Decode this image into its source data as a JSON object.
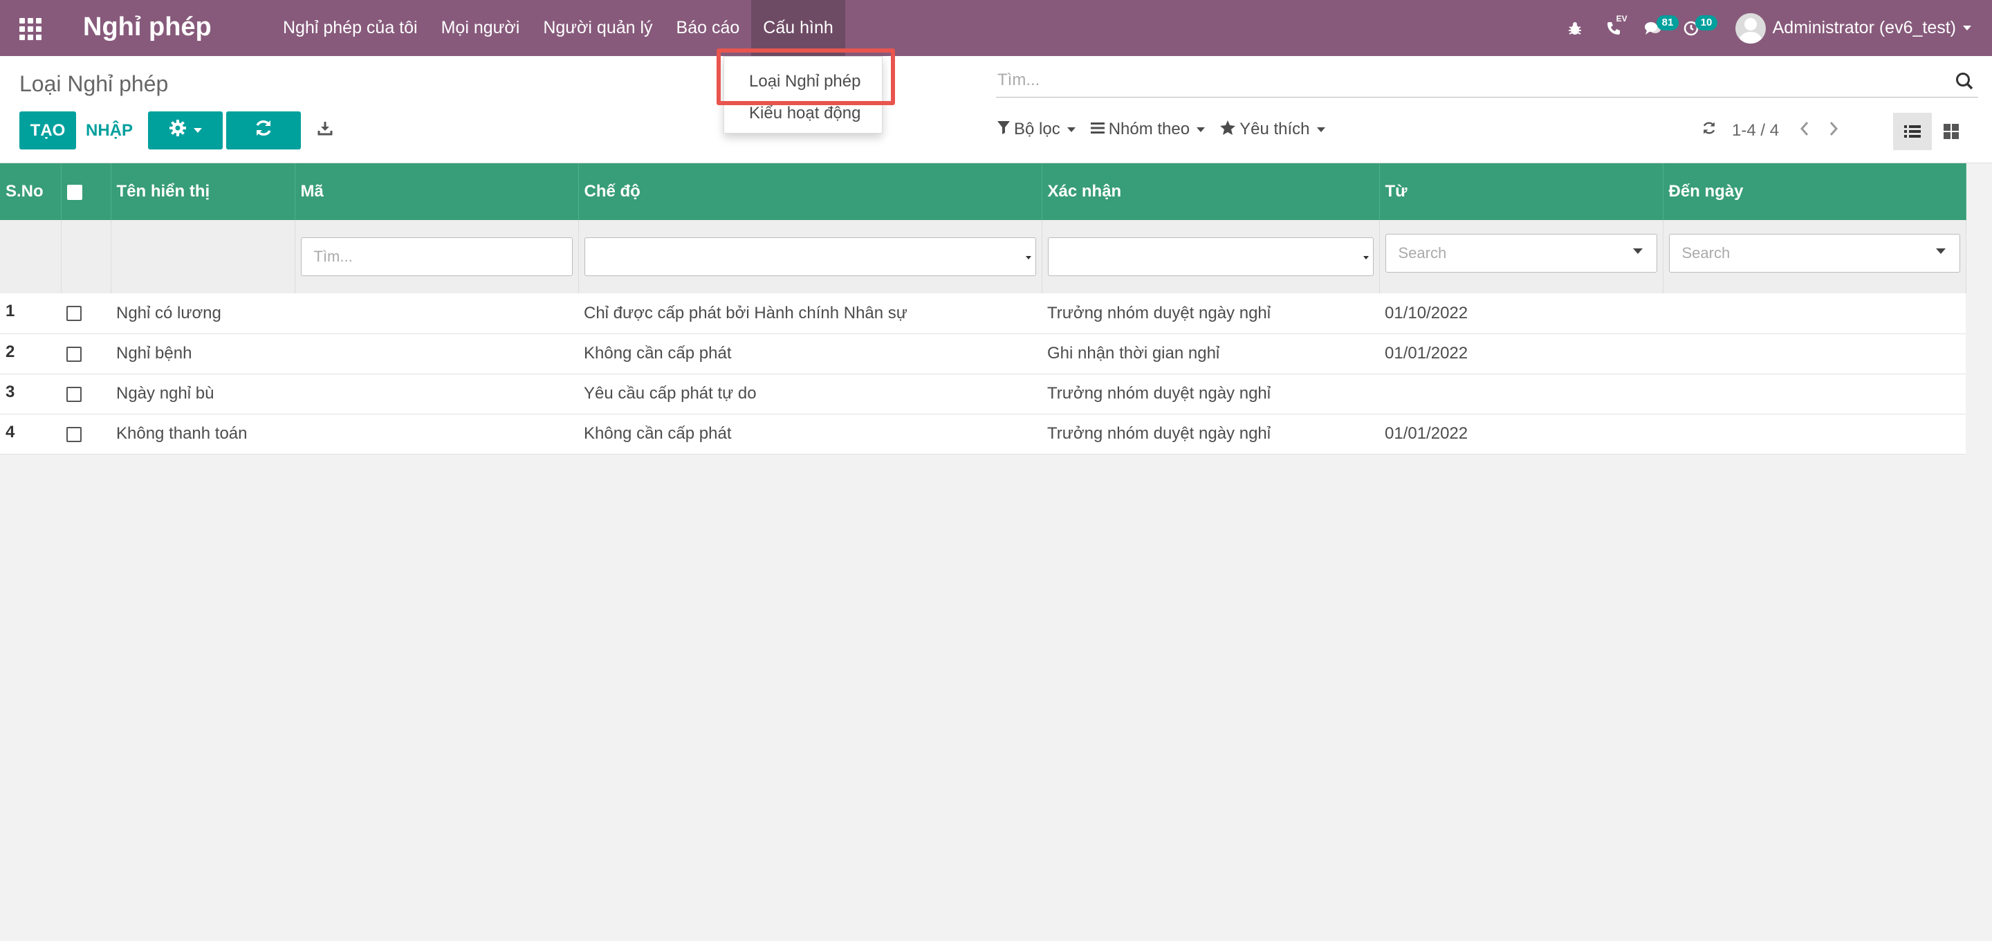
{
  "navbar": {
    "app_title": "Nghỉ phép",
    "menu": [
      "Nghỉ phép của tôi",
      "Mọi người",
      "Người quản lý",
      "Báo cáo",
      "Cấu hình"
    ],
    "active_menu": "Cấu hình",
    "ev_label": "EV",
    "messages_count": "81",
    "activities_count": "10",
    "user": "Administrator (ev6_test)"
  },
  "dropdown": {
    "items": [
      "Loại Nghỉ phép",
      "Kiểu hoạt động"
    ],
    "highlighted": "Loại Nghỉ phép"
  },
  "control_panel": {
    "breadcrumb": "Loại Nghỉ phép",
    "create_label": "TẠO",
    "import_label": "NHẬP",
    "search_placeholder": "Tìm...",
    "filters": {
      "filter_label": "Bộ lọc",
      "group_label": "Nhóm theo",
      "favorites_label": "Yêu thích"
    },
    "pager": "1-4 / 4"
  },
  "table": {
    "headers": [
      "S.No",
      "",
      "Tên hiển thị",
      "Mã",
      "Chế độ",
      "Xác nhận",
      "Từ",
      "Đến ngày"
    ],
    "filter_row": {
      "ma_placeholder": "Tìm...",
      "tu_placeholder": "Search",
      "den_placeholder": "Search"
    },
    "rows": [
      {
        "sno": "1",
        "name": "Nghỉ có lương",
        "code": "",
        "mode": "Chỉ được cấp phát bởi Hành chính Nhân sự",
        "validation": "Trưởng nhóm duyệt ngày nghỉ",
        "from": "01/10/2022",
        "to": ""
      },
      {
        "sno": "2",
        "name": "Nghỉ bệnh",
        "code": "",
        "mode": "Không cần cấp phát",
        "validation": "Ghi nhận thời gian nghỉ",
        "from": "01/01/2022",
        "to": ""
      },
      {
        "sno": "3",
        "name": "Ngày nghỉ bù",
        "code": "",
        "mode": "Yêu cầu cấp phát tự do",
        "validation": "Trưởng nhóm duyệt ngày nghỉ",
        "from": "",
        "to": ""
      },
      {
        "sno": "4",
        "name": "Không thanh toán",
        "code": "",
        "mode": "Không cần cấp phát",
        "validation": "Trưởng nhóm duyệt ngày nghỉ",
        "from": "01/01/2022",
        "to": ""
      }
    ]
  },
  "colors": {
    "navbar": "#875a7b",
    "primary": "#00a09d",
    "table_header": "#389d79",
    "highlight": "#e8554e"
  }
}
